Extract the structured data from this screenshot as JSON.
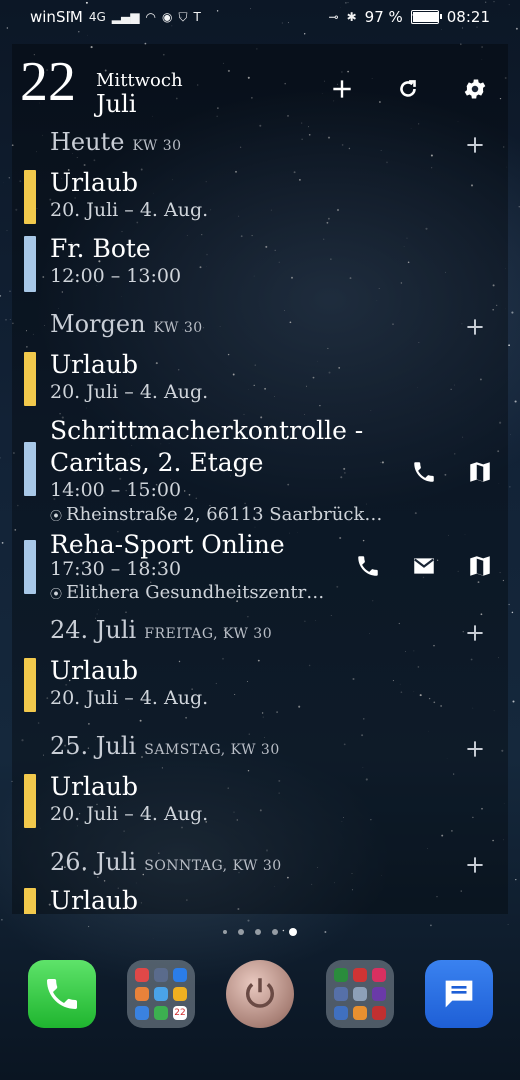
{
  "status_bar": {
    "carrier": "winSIM",
    "network": "4G",
    "battery_percent": "97 %",
    "battery_level": 0.97,
    "time": "08:21"
  },
  "header": {
    "day_number": "22",
    "weekday": "Mittwoch",
    "month": "Juli",
    "icons": [
      "add-icon",
      "refresh-icon",
      "settings-icon"
    ]
  },
  "days": [
    {
      "label": "Heute",
      "sub": "KW 30",
      "events": [
        {
          "title": "Urlaub",
          "time": "20. Juli – 4. Aug.",
          "color": "#f2c94c"
        },
        {
          "title": "Fr. Bote",
          "time": "12:00 – 13:00",
          "color": "#a8c8e8"
        }
      ]
    },
    {
      "label": "Morgen",
      "sub": "KW 30",
      "events": [
        {
          "title": "Urlaub",
          "time": "20. Juli – 4. Aug.",
          "color": "#f2c94c"
        },
        {
          "title_line1": "Schrittmacherkontrolle -",
          "title_line2": "Caritas, 2. Etage",
          "time": "14:00 – 15:00",
          "location": "Rheinstraße 2, 66113 Saarbrück…",
          "color": "#a8c8e8",
          "actions": [
            "phone-icon",
            "map-icon"
          ]
        },
        {
          "title": "Reha-Sport Online",
          "time": "17:30 – 18:30",
          "location": "Elithera Gesundheitszentr…",
          "color": "#a8c8e8",
          "actions": [
            "phone-icon",
            "mail-icon",
            "map-icon"
          ]
        }
      ]
    },
    {
      "label": "24. Juli",
      "sub": "FREITAG,  KW 30",
      "events": [
        {
          "title": "Urlaub",
          "time": "20. Juli – 4. Aug.",
          "color": "#f2c94c"
        }
      ]
    },
    {
      "label": "25. Juli",
      "sub": "SAMSTAG,  KW 30",
      "events": [
        {
          "title": "Urlaub",
          "time": "20. Juli – 4. Aug.",
          "color": "#f2c94c"
        }
      ]
    },
    {
      "label": "26. Juli",
      "sub": "SONNTAG,  KW 30",
      "events": [
        {
          "title": "Urlaub",
          "color": "#f2c94c"
        }
      ]
    }
  ],
  "page_indicator": {
    "count": 5,
    "active": 5
  },
  "dock": {
    "apps": [
      "phone-app",
      "folder-1",
      "power-app",
      "folder-2",
      "messages-app"
    ],
    "calendar_badge": "22"
  }
}
